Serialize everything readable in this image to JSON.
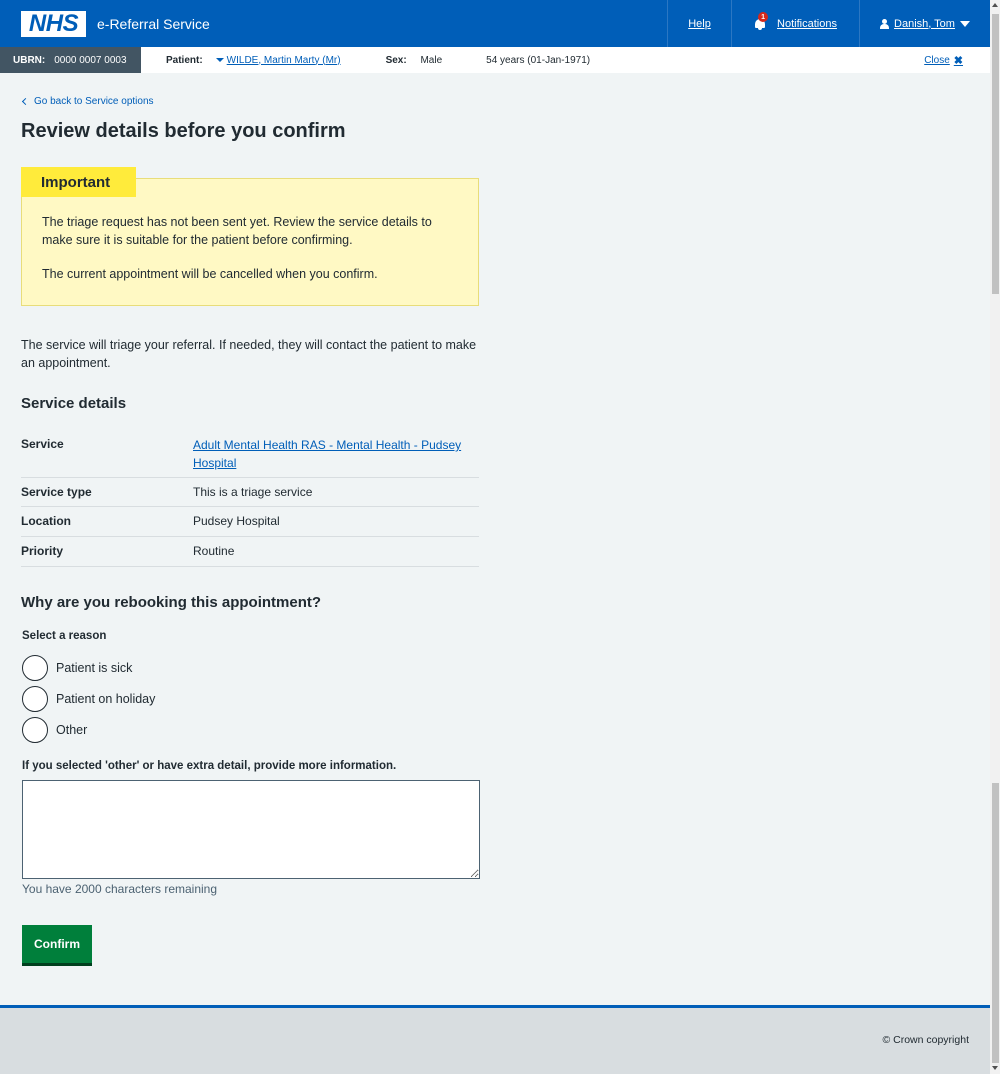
{
  "header": {
    "logo_text": "NHS",
    "service_name": "e-Referral Service",
    "help_label": "Help",
    "notifications_label": "Notifications",
    "notifications_count": "1",
    "user_label": "Danish, Tom"
  },
  "patient_banner": {
    "ubrn_label": "UBRN:",
    "ubrn_value": "0000 0007 0003",
    "patient_label": "Patient:",
    "patient_name": "WILDE, Martin Marty (Mr)",
    "sex_label": "Sex:",
    "sex_value": "Male",
    "age": "54 years (01-Jan-1971)",
    "close_label": "Close"
  },
  "main": {
    "back_link": "Go back to Service options",
    "title": "Review details before you confirm",
    "important": {
      "label": "Important",
      "p1": "The triage request has not been sent yet. Review the service details to make sure it is suitable for the patient before confirming.",
      "p2": "The current appointment will be cancelled when you confirm."
    },
    "intro": "The service will triage your referral. If needed, they will contact the patient to make an appointment.",
    "service_heading": "Service details",
    "service_rows": [
      {
        "key": "Service",
        "value": "Adult Mental Health RAS - Mental Health - Pudsey Hospital"
      },
      {
        "key": "Service type",
        "value": "This is a triage service"
      },
      {
        "key": "Location",
        "value": "Pudsey Hospital"
      },
      {
        "key": "Priority",
        "value": "Routine"
      }
    ],
    "why_heading": "Why are you rebooking this appointment?",
    "select_reason_label": "Select a reason",
    "reasons": [
      "Patient is sick",
      "Patient on holiday",
      "Other"
    ],
    "textarea_label": "If you selected 'other' or have extra detail, provide more information.",
    "textarea_value": "",
    "chars_remaining": "You have 2000 characters remaining",
    "confirm_label": "Confirm"
  },
  "footer": {
    "copyright": "© Crown copyright"
  },
  "colors": {
    "nhs_blue": "#005eb8",
    "important_bg": "#fff9c4",
    "important_label_bg": "#ffeb3b",
    "confirm_green": "#007f3b"
  }
}
